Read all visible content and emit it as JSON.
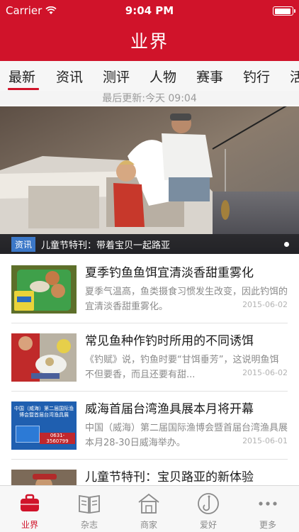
{
  "status_bar": {
    "carrier": "Carrier",
    "time": "9:04 PM"
  },
  "nav": {
    "title": "业界"
  },
  "tabs": [
    {
      "label": "最新"
    },
    {
      "label": "资讯"
    },
    {
      "label": "测评"
    },
    {
      "label": "人物"
    },
    {
      "label": "赛事"
    },
    {
      "label": "钓行"
    },
    {
      "label": "活"
    }
  ],
  "last_updated": "最后更新:今天 09:04",
  "hero": {
    "tag": "资讯",
    "caption": "儿童节特刊：带着宝贝一起路亚"
  },
  "articles": [
    {
      "title": "夏季钓鱼鱼饵宜清淡香甜重雾化",
      "summary": "夏季气温高，鱼类摄食习惯发生改变，因此钓饵的宜清淡香甜重雾化。",
      "date": "2015-06-02"
    },
    {
      "title": "常见鱼种作钓时所用的不同诱饵",
      "summary": "《钓赋》说，钓鱼时要“甘饵垂芳”，这说明鱼饵不但要香，而且还要有甜...",
      "date": "2015-06-02"
    },
    {
      "title": "威海首届台湾渔具展本月将开幕",
      "summary": "中国（威海）第二届国际渔博会暨首届台湾渔具展本月28-30日威海举办。",
      "date": "2015-06-01"
    },
    {
      "title": "儿童节特刊：宝贝路亚的新体验",
      "summary": "",
      "date": ""
    }
  ],
  "thumb3_text": {
    "banner": "中国（威海）第二届国际渔博会暨首届台湾渔具展",
    "phone": "0631-3560799"
  },
  "bottom_nav": [
    {
      "label": "业界",
      "icon": "briefcase-icon",
      "active": true
    },
    {
      "label": "杂志",
      "icon": "book-icon",
      "active": false
    },
    {
      "label": "商家",
      "icon": "store-icon",
      "active": false
    },
    {
      "label": "爱好",
      "icon": "hook-icon",
      "active": false
    },
    {
      "label": "更多",
      "icon": "more-icon",
      "active": false
    }
  ],
  "colors": {
    "brand_red": "#d0132a",
    "tag_blue": "#3c78c8",
    "muted_text": "#8a8a8a"
  }
}
